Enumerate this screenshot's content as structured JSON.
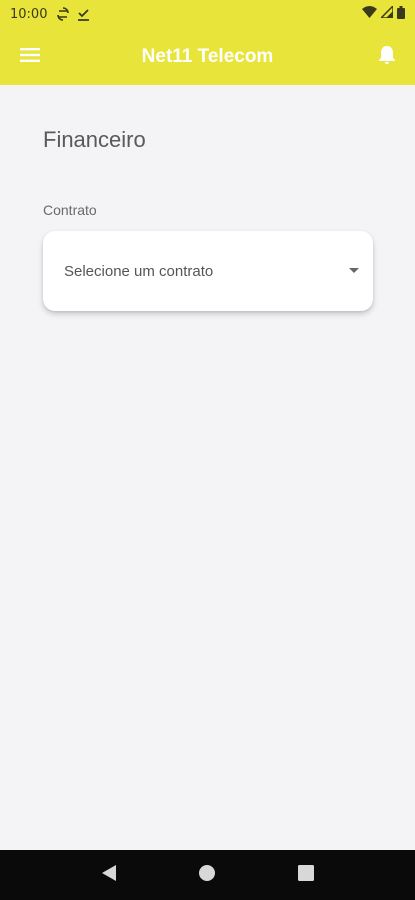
{
  "status_bar": {
    "time": "10:00",
    "left_icons": [
      "sync-icon",
      "download-done-icon"
    ],
    "right_icons": [
      "wifi-icon",
      "signal-icon",
      "battery-icon"
    ]
  },
  "app_bar": {
    "title": "Net11 Telecom",
    "background": "#e8e43a",
    "menu_icon": "hamburger-menu-icon",
    "notification_icon": "bell-icon"
  },
  "page": {
    "title": "Financeiro",
    "contract_label": "Contrato",
    "contract_select": {
      "placeholder": "Selecione um contrato",
      "icon": "dropdown-arrow-icon"
    }
  },
  "nav_bar": {
    "buttons": [
      "back-icon",
      "home-icon",
      "recents-icon"
    ]
  }
}
